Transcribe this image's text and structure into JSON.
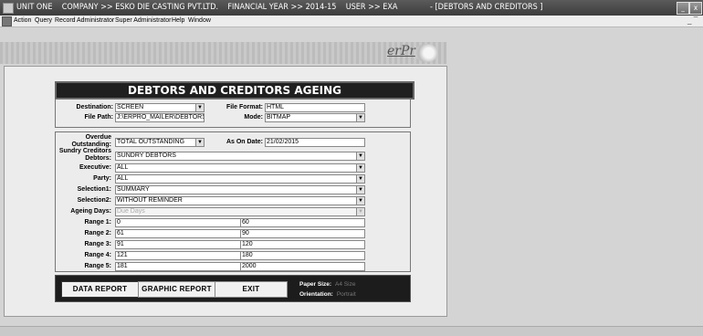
{
  "titlebar": {
    "left": "UNIT ONE    COMPANY >> ESKO DIE CASTING PVT.LTD.    FINANCIAL YEAR >> 2014-15    USER >> EXA",
    "right": "- [DEBTORS AND CREDITORS ]",
    "minimize": "_",
    "close": "x"
  },
  "menu": [
    "Action",
    "Query",
    "Record",
    "Administrator",
    "Super Administrator",
    "Help",
    "Window"
  ],
  "mdi_controls": {
    "minimize": "_",
    "restore": "̅"
  },
  "logo": "erPro",
  "form_title": "DEBTORS AND CREDITORS AGEING",
  "top": {
    "destination_label": "Destination:",
    "destination_value": "SCREEN",
    "file_format_label": "File Format:",
    "file_format_value": "HTML",
    "file_path_label": "File Path:",
    "file_path_value": "J:\\ERPRO_MAILER\\DEBTORS",
    "mode_label": "Mode:",
    "mode_value": "BITMAP"
  },
  "filters": {
    "overdue_label": "Overdue Outstanding:",
    "overdue_value": "TOTAL OUTSTANDING",
    "as_on_label": "As On Date:",
    "as_on_value": "21/02/2015",
    "sundry_label": "Sundry Creditors Debtors:",
    "sundry_value": "SUNDRY DEBTORS",
    "executive_label": "Executive:",
    "executive_value": "ALL",
    "party_label": "Party:",
    "party_value": "ALL",
    "selection1_label": "Selection1:",
    "selection1_value": "SUMMARY",
    "selection2_label": "Selection2:",
    "selection2_value": "WITHOUT REMINDER",
    "ageing_label": "Ageing Days:",
    "ageing_value": "Due Days"
  },
  "ranges": [
    {
      "label": "Range 1:",
      "from": "0",
      "to": "60"
    },
    {
      "label": "Range 2:",
      "from": "61",
      "to": "90"
    },
    {
      "label": "Range 3:",
      "from": "91",
      "to": "120"
    },
    {
      "label": "Range 4:",
      "from": "121",
      "to": "180"
    },
    {
      "label": "Range 5:",
      "from": "181",
      "to": "2000"
    }
  ],
  "buttons": {
    "data_report": "DATA REPORT",
    "graphic_report": "GRAPHIC REPORT",
    "exit": "EXIT"
  },
  "paper": {
    "size_label": "Paper Size:",
    "size_value": "A4 Size",
    "orientation_label": "Orientation:",
    "orientation_value": "Portrait"
  }
}
